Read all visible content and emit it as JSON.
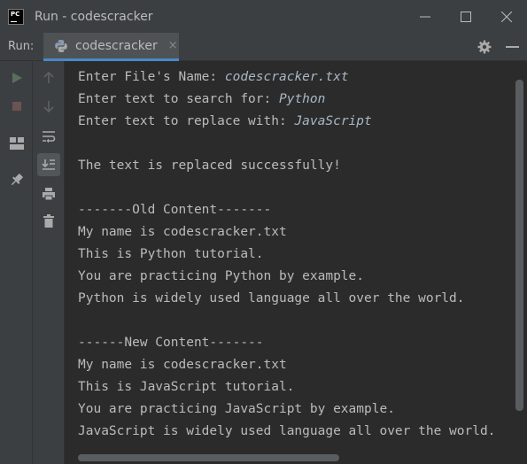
{
  "window": {
    "app_logo_text": "PC",
    "title": "Run - codescracker"
  },
  "toolbar": {
    "run_label": "Run:",
    "tab_label": "codescracker",
    "tab_close": "×"
  },
  "console": {
    "prompt_file": "Enter File's Name: ",
    "input_file": "codescracker.txt",
    "prompt_search": "Enter text to search for: ",
    "input_search": "Python",
    "prompt_replace": "Enter text to replace with: ",
    "input_replace": "JavaScript",
    "success": "The text is replaced successfully!",
    "old_header": "-------Old Content-------",
    "old_lines": [
      "My name is codescracker.txt",
      "This is Python tutorial.",
      "You are practicing Python by example.",
      "Python is widely used language all over the world."
    ],
    "new_header": "------New Content-------",
    "new_lines": [
      "My name is codescracker.txt",
      "This is JavaScript tutorial.",
      "You are practicing JavaScript by example.",
      "JavaScript is widely used language all over the world."
    ]
  },
  "colors": {
    "background": "#2b2b2b",
    "panel": "#3c3f41",
    "tab_underline": "#4a88c7",
    "text": "#bbbbbb",
    "run_icon": "#499c54"
  },
  "icons": {
    "app": "pycharm-logo-icon",
    "tab": "python-icon",
    "settings": "gear-icon",
    "hide": "minimize-panel-icon"
  }
}
